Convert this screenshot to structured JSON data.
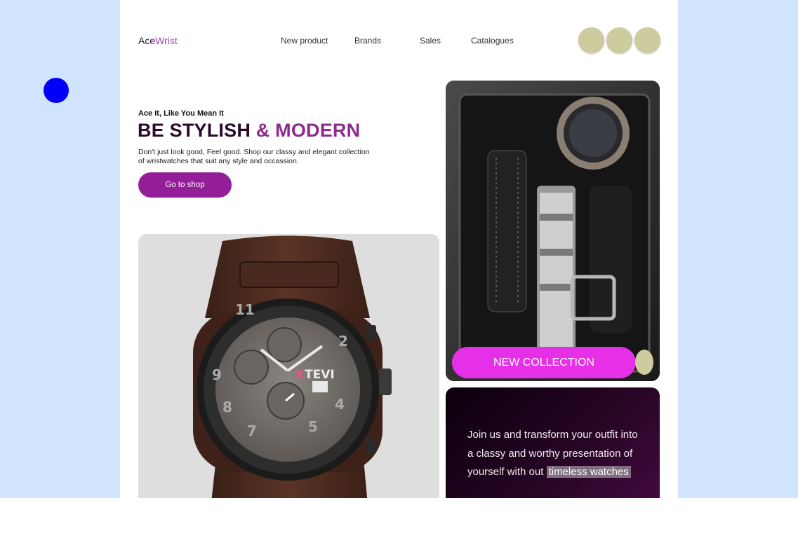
{
  "brand": {
    "name_main": "Ace",
    "name_accent": "Wrist"
  },
  "nav": [
    {
      "label": "New product"
    },
    {
      "label": "Brands"
    },
    {
      "label": "Sales"
    },
    {
      "label": "Catalogues"
    }
  ],
  "hero": {
    "tagline": "Ace It, Like You Mean It",
    "headline_part1": "BE STYLISH ",
    "headline_part2": "& MODERN",
    "description": "Don't just look good, Feel good. Shop our classy and elegant collection of wristwatches that suit any style and occassion.",
    "cta_label": "Go to shop"
  },
  "watch_face": {
    "brand_k": "K",
    "brand_rest": "TEVI"
  },
  "collection": {
    "button_label": "NEW COLLECTION"
  },
  "promo": {
    "text": "Join us and transform your outfit into a classy and worthy presentation of yourself with out",
    "highlight": "timeless watches"
  },
  "colors": {
    "accent": "#931e98",
    "pink": "#e530e8",
    "headline_dark": "#2a0a26",
    "headline_purple": "#8e2a8e",
    "page_bg": "#d0e4fd",
    "circle": "#cdcc9e"
  },
  "icons": [
    "profile-circle-icon",
    "cart-circle-icon",
    "menu-circle-icon"
  ]
}
